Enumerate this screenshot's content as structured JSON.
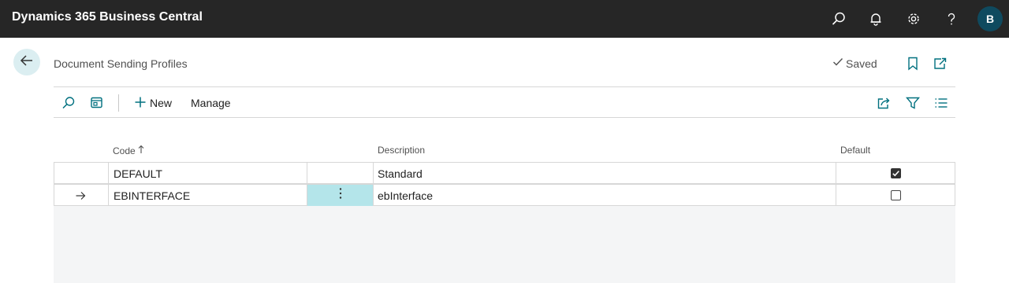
{
  "app": {
    "title": "Dynamics 365 Business Central",
    "user_initial": "B"
  },
  "topbar_icons": [
    "search-icon",
    "bell-icon",
    "gear-icon",
    "help-icon"
  ],
  "header": {
    "title": "Document Sending Profiles",
    "status": "Saved"
  },
  "actions": {
    "new_label": "New",
    "manage_label": "Manage"
  },
  "columns": {
    "code": "Code",
    "description": "Description",
    "default": "Default"
  },
  "rows": [
    {
      "code": "DEFAULT",
      "description": "Standard",
      "default": true,
      "selected": false
    },
    {
      "code": "EBINTERFACE",
      "description": "ebInterface",
      "default": false,
      "selected": true
    }
  ],
  "colors": {
    "topbar": "#262626",
    "accent": "#00707f",
    "selection": "#b4e5ea",
    "avatar": "#0f4a5f"
  }
}
